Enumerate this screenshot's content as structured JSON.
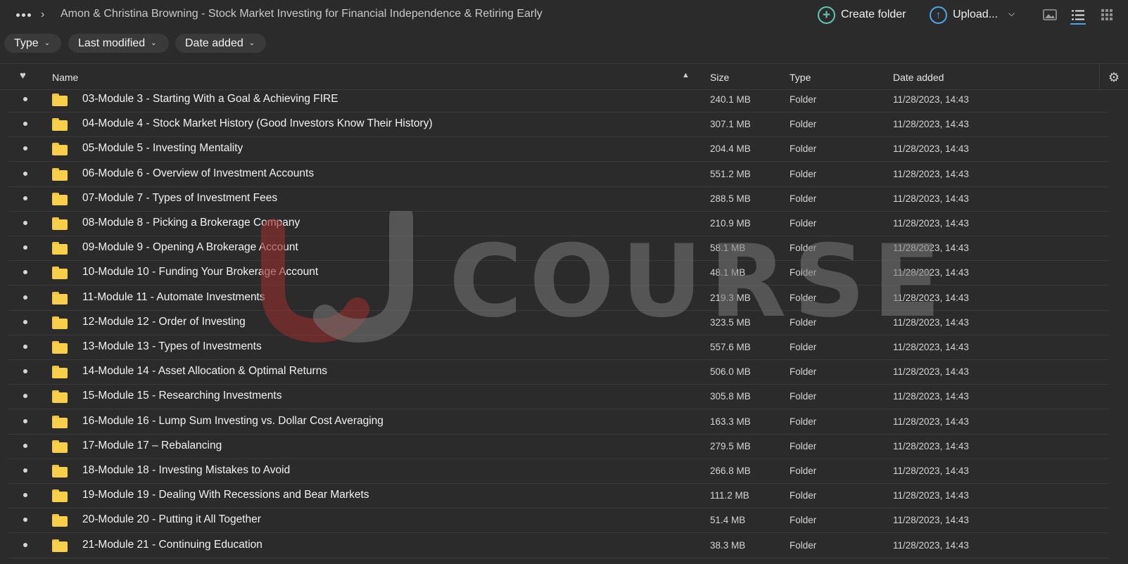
{
  "breadcrumb": {
    "title": "Amon & Christina Browning - Stock Market Investing for Financial Independence & Retiring Early"
  },
  "toolbar": {
    "create_folder_label": "Create folder",
    "upload_label": "Upload..."
  },
  "filters": {
    "type": "Type",
    "last_modified": "Last modified",
    "date_added": "Date added"
  },
  "columns": {
    "name": "Name",
    "size": "Size",
    "type": "Type",
    "date_added": "Date added"
  },
  "watermark": {
    "text": "COURSE"
  },
  "rows": [
    {
      "name": "03-Module 3 - Starting With a Goal & Achieving FIRE",
      "size": "240.1 MB",
      "type": "Folder",
      "date": "11/28/2023, 14:43"
    },
    {
      "name": "04-Module 4 - Stock Market History (Good Investors Know Their History)",
      "size": "307.1 MB",
      "type": "Folder",
      "date": "11/28/2023, 14:43"
    },
    {
      "name": "05-Module 5 - Investing Mentality",
      "size": "204.4 MB",
      "type": "Folder",
      "date": "11/28/2023, 14:43"
    },
    {
      "name": "06-Module 6 - Overview of Investment Accounts",
      "size": "551.2 MB",
      "type": "Folder",
      "date": "11/28/2023, 14:43"
    },
    {
      "name": "07-Module 7 - Types of Investment Fees",
      "size": "288.5 MB",
      "type": "Folder",
      "date": "11/28/2023, 14:43"
    },
    {
      "name": "08-Module 8 - Picking a Brokerage Company",
      "size": "210.9 MB",
      "type": "Folder",
      "date": "11/28/2023, 14:43"
    },
    {
      "name": "09-Module 9 - Opening A Brokerage Account",
      "size": "58.1 MB",
      "type": "Folder",
      "date": "11/28/2023, 14:43"
    },
    {
      "name": "10-Module 10 - Funding Your Brokerage Account",
      "size": "48.1 MB",
      "type": "Folder",
      "date": "11/28/2023, 14:43"
    },
    {
      "name": "11-Module 11 - Automate Investments",
      "size": "219.3 MB",
      "type": "Folder",
      "date": "11/28/2023, 14:43"
    },
    {
      "name": "12-Module 12 - Order of Investing",
      "size": "323.5 MB",
      "type": "Folder",
      "date": "11/28/2023, 14:43"
    },
    {
      "name": "13-Module 13 - Types of Investments",
      "size": "557.6 MB",
      "type": "Folder",
      "date": "11/28/2023, 14:43"
    },
    {
      "name": "14-Module 14 - Asset Allocation & Optimal Returns",
      "size": "506.0 MB",
      "type": "Folder",
      "date": "11/28/2023, 14:43"
    },
    {
      "name": "15-Module 15 - Researching Investments",
      "size": "305.8 MB",
      "type": "Folder",
      "date": "11/28/2023, 14:43"
    },
    {
      "name": "16-Module 16 - Lump Sum Investing vs. Dollar Cost Averaging",
      "size": "163.3 MB",
      "type": "Folder",
      "date": "11/28/2023, 14:43"
    },
    {
      "name": "17-Module 17 – Rebalancing",
      "size": "279.5 MB",
      "type": "Folder",
      "date": "11/28/2023, 14:43"
    },
    {
      "name": "18-Module 18 - Investing Mistakes to Avoid",
      "size": "266.8 MB",
      "type": "Folder",
      "date": "11/28/2023, 14:43"
    },
    {
      "name": "19-Module 19 - Dealing With Recessions and Bear Markets",
      "size": "111.2 MB",
      "type": "Folder",
      "date": "11/28/2023, 14:43"
    },
    {
      "name": "20-Module 20 - Putting it All Together",
      "size": "51.4 MB",
      "type": "Folder",
      "date": "11/28/2023, 14:43"
    },
    {
      "name": "21-Module 21 - Continuing Education",
      "size": "38.3 MB",
      "type": "Folder",
      "date": "11/28/2023, 14:43"
    }
  ]
}
